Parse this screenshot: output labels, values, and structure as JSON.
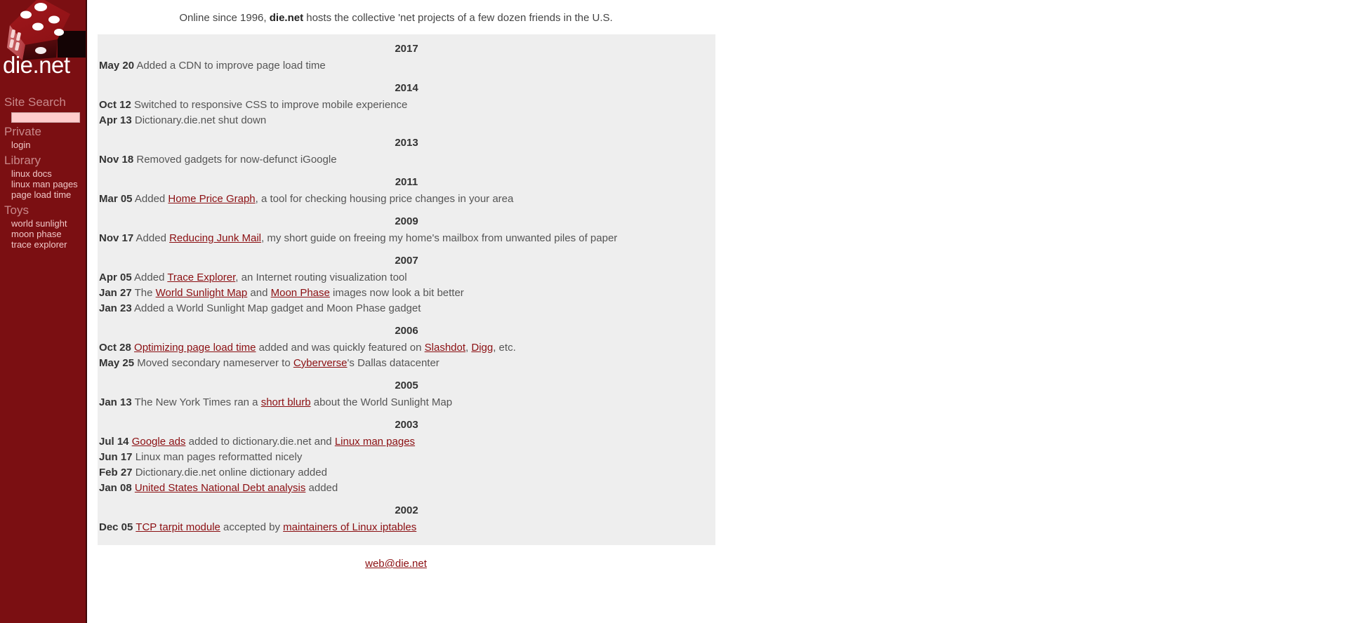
{
  "colors": {
    "sidebar_bg": "#7b0f12",
    "sidebar_border": "#3d0708",
    "sidebar_heading": "#c8888a",
    "sidebar_link": "#f0c8c8",
    "search_field_bg": "#ffcccc",
    "panel_bg": "#eeeeee",
    "link": "#8b0f12",
    "body_text": "#555555",
    "emphasis_text": "#333333",
    "page_bg": "#ffffff"
  },
  "sidebar": {
    "logo_alt": "die-logo",
    "wordmark": "die.net",
    "search": {
      "heading": "Site Search",
      "value": "",
      "placeholder": ""
    },
    "groups": [
      {
        "heading": "Private",
        "items": [
          {
            "label": "login"
          }
        ]
      },
      {
        "heading": "Library",
        "items": [
          {
            "label": "linux docs"
          },
          {
            "label": "linux man pages"
          },
          {
            "label": "page load time"
          }
        ]
      },
      {
        "heading": "Toys",
        "items": [
          {
            "label": "world sunlight"
          },
          {
            "label": "moon phase"
          },
          {
            "label": "trace explorer"
          }
        ]
      }
    ]
  },
  "main": {
    "tagline": {
      "before": "Online since 1996, ",
      "brand": "die.net",
      "after": " hosts the collective 'net projects of a few dozen friends in the U.S."
    },
    "timeline": [
      {
        "year": "2017",
        "entries": [
          {
            "date": "May 20",
            "parts": [
              {
                "type": "text",
                "text": "Added a CDN to improve page load time"
              }
            ]
          }
        ]
      },
      {
        "year": "2014",
        "entries": [
          {
            "date": "Oct 12",
            "parts": [
              {
                "type": "text",
                "text": "Switched to responsive CSS to improve mobile experience"
              }
            ]
          },
          {
            "date": "Apr 13",
            "parts": [
              {
                "type": "text",
                "text": "Dictionary.die.net shut down"
              }
            ]
          }
        ]
      },
      {
        "year": "2013",
        "entries": [
          {
            "date": "Nov 18",
            "parts": [
              {
                "type": "text",
                "text": "Removed gadgets for now-defunct iGoogle"
              }
            ]
          }
        ]
      },
      {
        "year": "2011",
        "entries": [
          {
            "date": "Mar 05",
            "parts": [
              {
                "type": "text",
                "text": "Added "
              },
              {
                "type": "link",
                "text": "Home Price Graph"
              },
              {
                "type": "text",
                "text": ", a tool for checking housing price changes in your area"
              }
            ]
          }
        ]
      },
      {
        "year": "2009",
        "entries": [
          {
            "date": "Nov 17",
            "parts": [
              {
                "type": "text",
                "text": "Added "
              },
              {
                "type": "link",
                "text": "Reducing Junk Mail"
              },
              {
                "type": "text",
                "text": ", my short guide on freeing my home's mailbox from unwanted piles of paper"
              }
            ]
          }
        ]
      },
      {
        "year": "2007",
        "entries": [
          {
            "date": "Apr 05",
            "parts": [
              {
                "type": "text",
                "text": "Added "
              },
              {
                "type": "link",
                "text": "Trace Explorer"
              },
              {
                "type": "text",
                "text": ", an Internet routing visualization tool"
              }
            ]
          },
          {
            "date": "Jan 27",
            "parts": [
              {
                "type": "text",
                "text": "The "
              },
              {
                "type": "link",
                "text": "World Sunlight Map"
              },
              {
                "type": "text",
                "text": " and "
              },
              {
                "type": "link",
                "text": "Moon Phase"
              },
              {
                "type": "text",
                "text": " images now look a bit better"
              }
            ]
          },
          {
            "date": "Jan 23",
            "parts": [
              {
                "type": "text",
                "text": "Added a World Sunlight Map gadget and Moon Phase gadget"
              }
            ]
          }
        ]
      },
      {
        "year": "2006",
        "entries": [
          {
            "date": "Oct 28",
            "parts": [
              {
                "type": "link",
                "text": "Optimizing page load time"
              },
              {
                "type": "text",
                "text": " added and was quickly featured on "
              },
              {
                "type": "link",
                "text": "Slashdot"
              },
              {
                "type": "text",
                "text": ", "
              },
              {
                "type": "link",
                "text": "Digg"
              },
              {
                "type": "text",
                "text": ", etc."
              }
            ]
          },
          {
            "date": "May 25",
            "parts": [
              {
                "type": "text",
                "text": "Moved secondary nameserver to "
              },
              {
                "type": "link",
                "text": "Cyberverse"
              },
              {
                "type": "text",
                "text": "'s Dallas datacenter"
              }
            ]
          }
        ]
      },
      {
        "year": "2005",
        "entries": [
          {
            "date": "Jan 13",
            "parts": [
              {
                "type": "text",
                "text": "The New York Times ran a "
              },
              {
                "type": "link",
                "text": "short blurb"
              },
              {
                "type": "text",
                "text": " about the World Sunlight Map"
              }
            ]
          }
        ]
      },
      {
        "year": "2003",
        "entries": [
          {
            "date": "Jul 14",
            "parts": [
              {
                "type": "link",
                "text": "Google ads"
              },
              {
                "type": "text",
                "text": " added to dictionary.die.net and "
              },
              {
                "type": "link",
                "text": "Linux man pages"
              }
            ]
          },
          {
            "date": "Jun 17",
            "parts": [
              {
                "type": "text",
                "text": "Linux man pages reformatted nicely"
              }
            ]
          },
          {
            "date": "Feb 27",
            "parts": [
              {
                "type": "text",
                "text": "Dictionary.die.net online dictionary added"
              }
            ]
          },
          {
            "date": "Jan 08",
            "parts": [
              {
                "type": "link",
                "text": "United States National Debt analysis"
              },
              {
                "type": "text",
                "text": " added"
              }
            ]
          }
        ]
      },
      {
        "year": "2002",
        "entries": [
          {
            "date": "Dec 05",
            "parts": [
              {
                "type": "link",
                "text": "TCP tarpit module"
              },
              {
                "type": "text",
                "text": " accepted by "
              },
              {
                "type": "link",
                "text": "maintainers of Linux iptables"
              }
            ]
          }
        ]
      }
    ],
    "footer": {
      "email": "web@die.net"
    }
  }
}
